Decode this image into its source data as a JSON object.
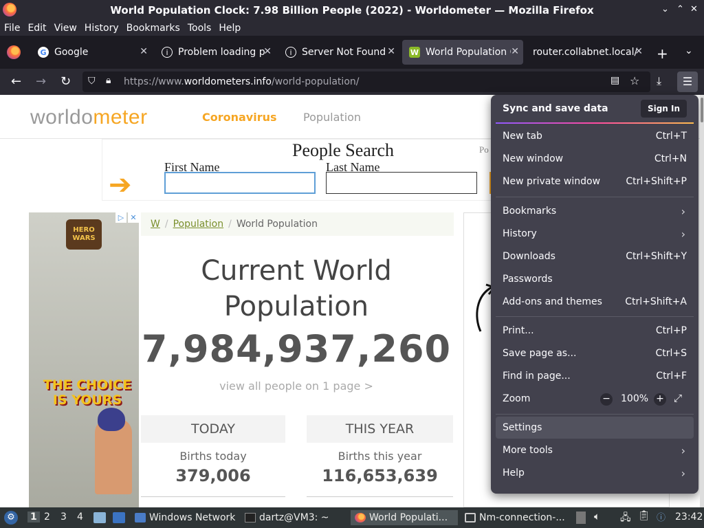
{
  "window": {
    "title": "World Population Clock: 7.98 Billion People (2022) - Worldometer — Mozilla Firefox",
    "min": "⌄",
    "max": "⌃",
    "close": "✕"
  },
  "menubar": [
    "File",
    "Edit",
    "View",
    "History",
    "Bookmarks",
    "Tools",
    "Help"
  ],
  "tabs": [
    {
      "label": "Google",
      "active": false
    },
    {
      "label": "Problem loading p",
      "active": false
    },
    {
      "label": "Server Not Found",
      "active": false
    },
    {
      "label": "World Population C",
      "active": true
    },
    {
      "label": "router.collabnet.local/",
      "active": false
    }
  ],
  "toolbar": {
    "url_prefix": "https://www.",
    "url_domain": "worldometers.info",
    "url_path": "/world-population/"
  },
  "site": {
    "logo_a": "worldo",
    "logo_b": "meter",
    "nav_coronavirus": "Coronavirus",
    "nav_population": "Population",
    "people_search_title": "People Search",
    "first_name_label": "First Name",
    "last_name_label": "Last Name",
    "po_text": "Po",
    "breadcrumb": {
      "home": "W",
      "sep": "/",
      "population": "Population",
      "current": "World Population"
    },
    "heading": "Current World Population",
    "counter": "7,984,937,260",
    "view_all": "view all people on 1 page >",
    "today_header": "TODAY",
    "year_header": "THIS YEAR",
    "births_today_label": "Births today",
    "births_today_value": "379,006",
    "births_year_label": "Births this year",
    "births_year_value": "116,653,639",
    "ad_logo": "HERO WARS",
    "ad_tagline": "THE CHOICE IS YOURS"
  },
  "appmenu": {
    "sync_title": "Sync and save data",
    "sign_in": "Sign In",
    "items": [
      {
        "label": "New tab",
        "shortcut": "Ctrl+T"
      },
      {
        "label": "New window",
        "shortcut": "Ctrl+N"
      },
      {
        "label": "New private window",
        "shortcut": "Ctrl+Shift+P"
      },
      {
        "label": "Bookmarks",
        "shortcut": "›"
      },
      {
        "label": "History",
        "shortcut": "›"
      },
      {
        "label": "Downloads",
        "shortcut": "Ctrl+Shift+Y"
      },
      {
        "label": "Passwords",
        "shortcut": ""
      },
      {
        "label": "Add-ons and themes",
        "shortcut": "Ctrl+Shift+A"
      },
      {
        "label": "Print...",
        "shortcut": "Ctrl+P"
      },
      {
        "label": "Save page as...",
        "shortcut": "Ctrl+S"
      },
      {
        "label": "Find in page...",
        "shortcut": "Ctrl+F"
      },
      {
        "label": "Zoom",
        "shortcut": ""
      },
      {
        "label": "Settings",
        "shortcut": ""
      },
      {
        "label": "More tools",
        "shortcut": "›"
      },
      {
        "label": "Help",
        "shortcut": "›"
      }
    ],
    "zoom_level": "100%"
  },
  "taskbar": {
    "workspaces": [
      "1",
      "2",
      "3",
      "4"
    ],
    "items": [
      "Windows Network",
      "dartz@VM3: ~",
      "World Populati...",
      "Nm-connection-..."
    ],
    "clock": "23:42"
  },
  "colors": {
    "accent_orange": "#f6a623",
    "link_green": "#7a8f2c",
    "menu_bg": "#42414d"
  }
}
